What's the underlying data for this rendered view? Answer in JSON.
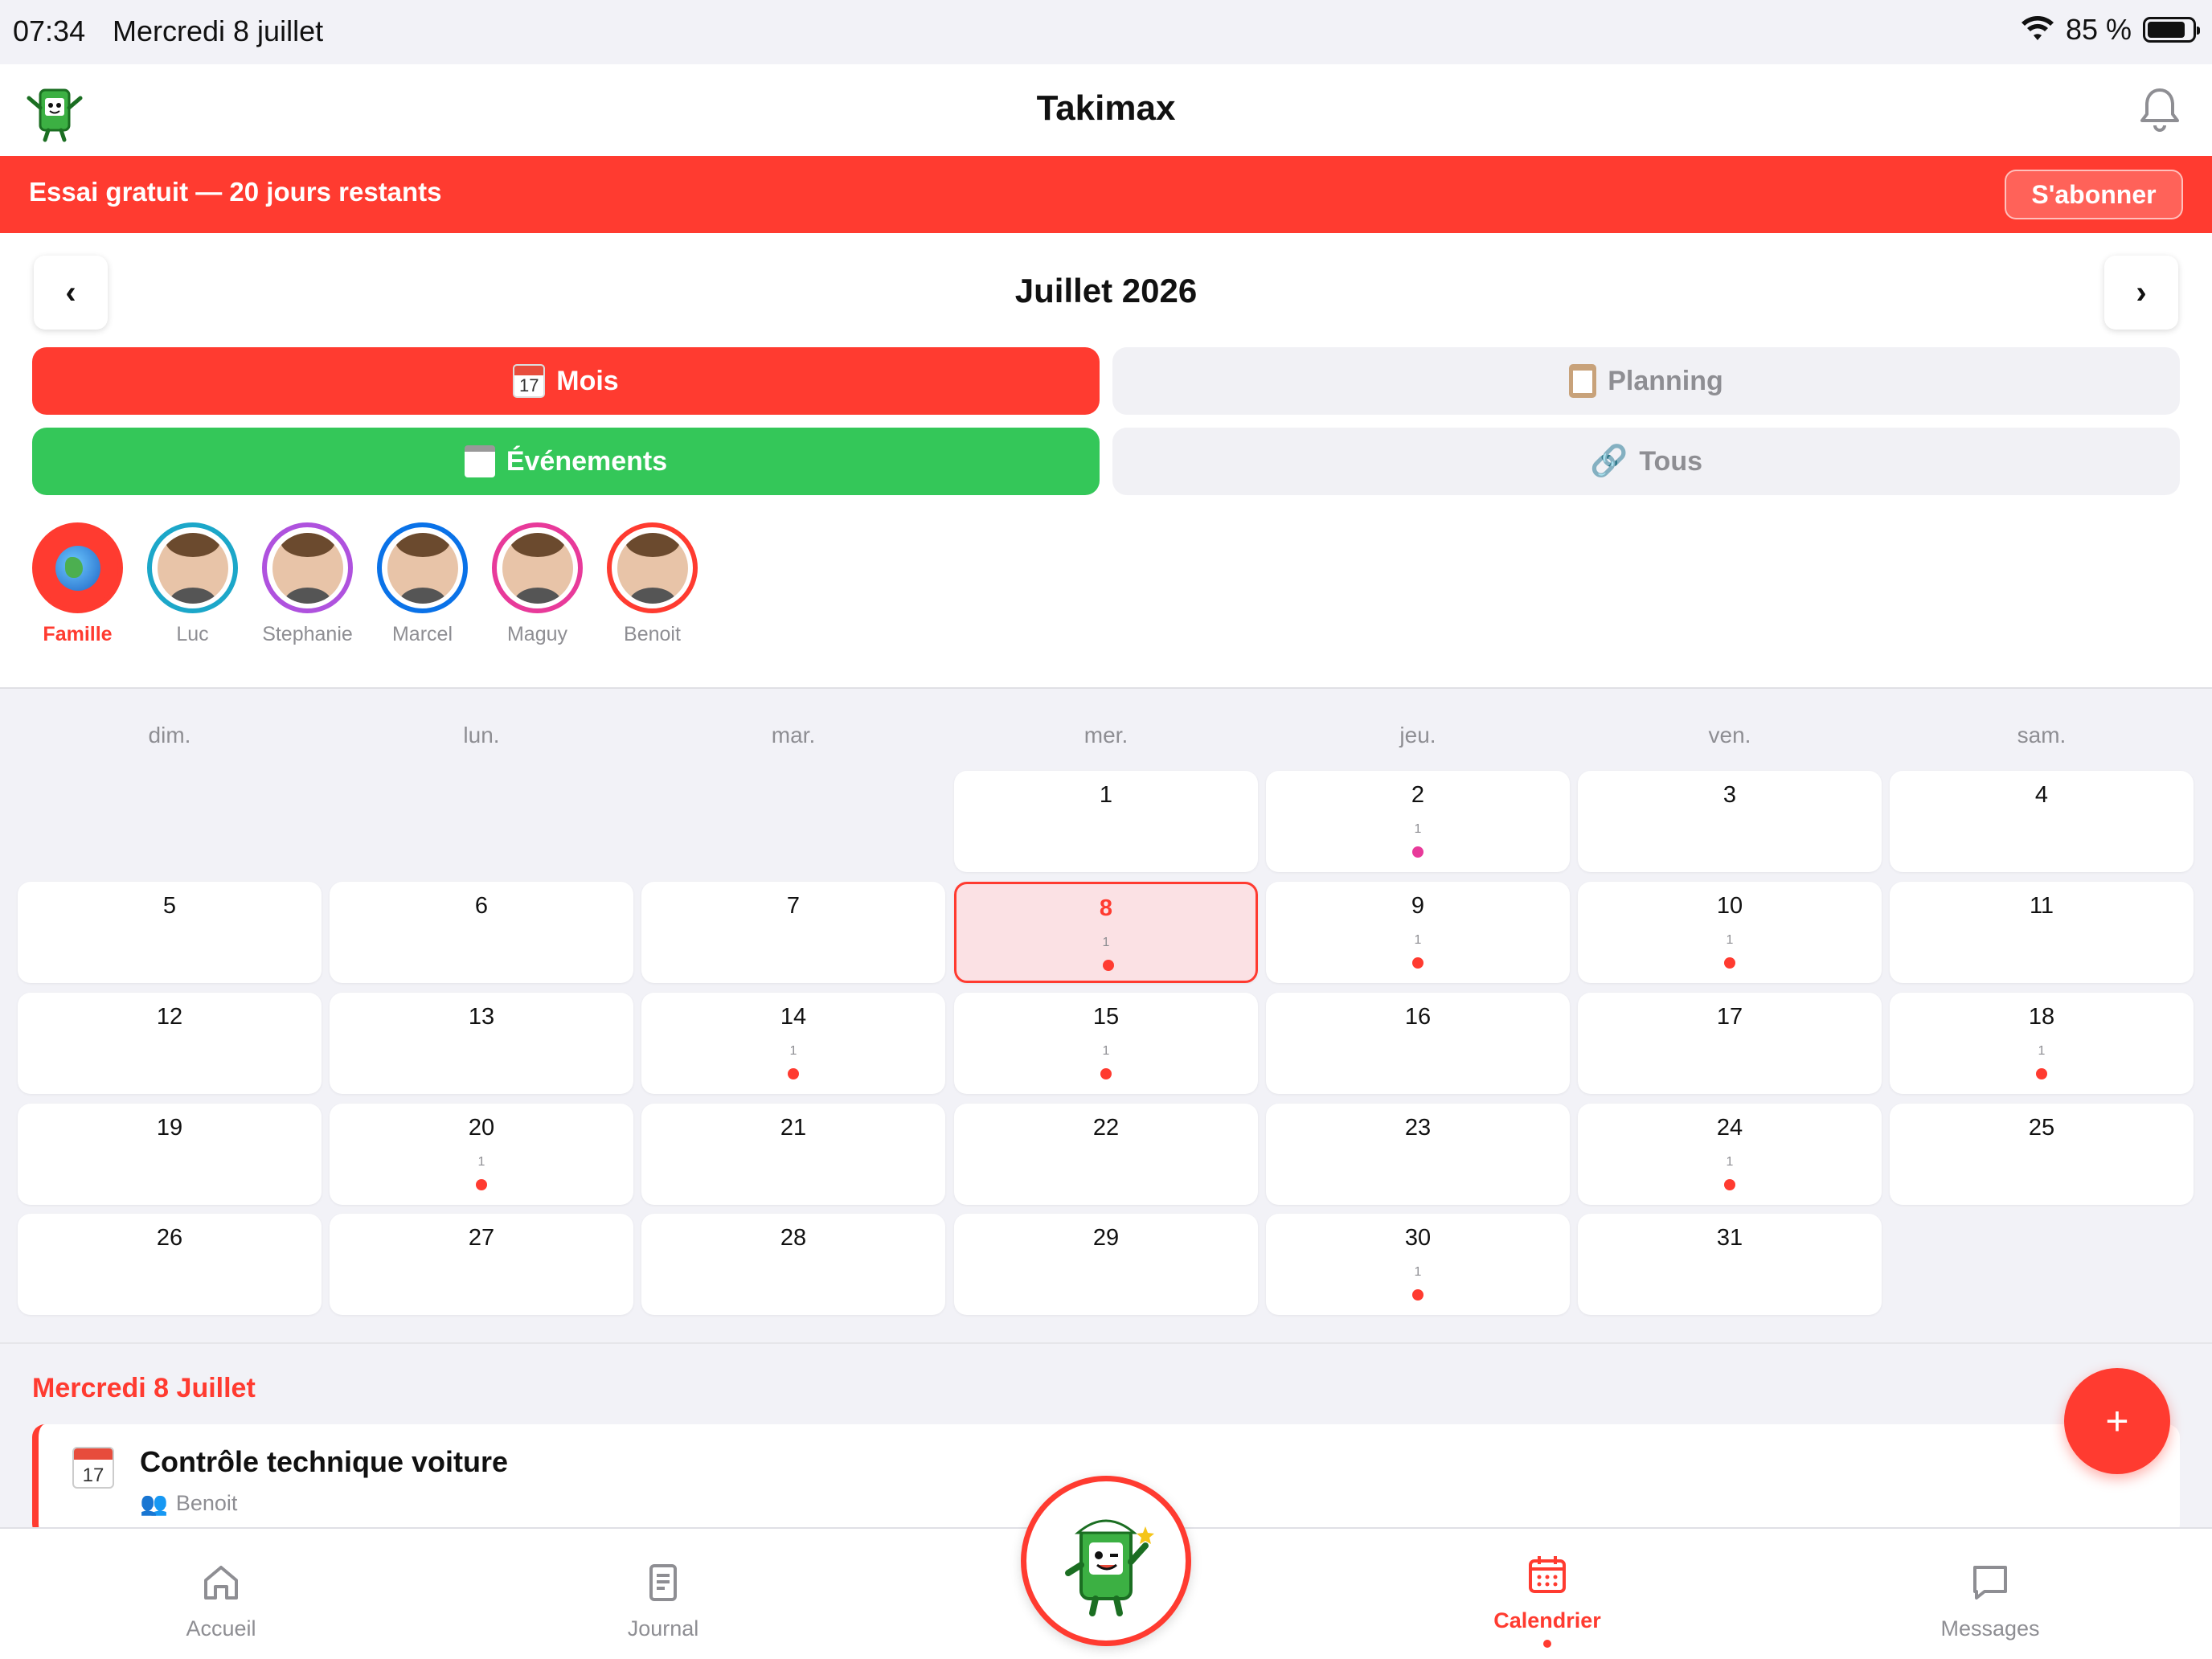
{
  "status_bar": {
    "time": "07:34",
    "date": "Mercredi 8 juillet",
    "battery": "85 %"
  },
  "header": {
    "title": "Takimax"
  },
  "banner": {
    "text": "Essai gratuit — 20 jours restants",
    "button": "S'abonner"
  },
  "calendar_nav": {
    "title": "Juillet 2026",
    "prev": "‹",
    "next": "›"
  },
  "view_tabs": {
    "month": {
      "icon_text": "17",
      "label": "Mois"
    },
    "planning": {
      "label": "Planning"
    },
    "events": {
      "label": "Événements"
    },
    "all": {
      "label": "Tous"
    }
  },
  "members": [
    {
      "name": "Famille",
      "ring_color": "#ff3b30",
      "active": true,
      "icon": "globe-icon"
    },
    {
      "name": "Luc",
      "ring_color": "#1ca7c9"
    },
    {
      "name": "Stephanie",
      "ring_color": "#af52de"
    },
    {
      "name": "Marcel",
      "ring_color": "#0a72e8"
    },
    {
      "name": "Maguy",
      "ring_color": "#e83a9a"
    },
    {
      "name": "Benoit",
      "ring_color": "#ff3b30"
    }
  ],
  "weekdays": [
    "dim.",
    "lun.",
    "mar.",
    "mer.",
    "jeu.",
    "ven.",
    "sam."
  ],
  "days": [
    {
      "day": "1",
      "count": ""
    },
    {
      "day": "2",
      "count": "1",
      "dot": "#e83a9a"
    },
    {
      "day": "3",
      "count": ""
    },
    {
      "day": "4",
      "count": ""
    },
    {
      "day": "5",
      "count": ""
    },
    {
      "day": "6",
      "count": ""
    },
    {
      "day": "7",
      "count": ""
    },
    {
      "day": "8",
      "count": "1",
      "dot": "#ff3b30",
      "today": true
    },
    {
      "day": "9",
      "count": "1",
      "dot": "#ff3b30"
    },
    {
      "day": "10",
      "count": "1",
      "dot": "#ff3b30"
    },
    {
      "day": "11",
      "count": ""
    },
    {
      "day": "12",
      "count": ""
    },
    {
      "day": "13",
      "count": ""
    },
    {
      "day": "14",
      "count": "1",
      "dot": "#ff3b30"
    },
    {
      "day": "15",
      "count": "1",
      "dot": "#ff3b30"
    },
    {
      "day": "16",
      "count": ""
    },
    {
      "day": "17",
      "count": ""
    },
    {
      "day": "18",
      "count": "1",
      "dot": "#ff3b30"
    },
    {
      "day": "19",
      "count": ""
    },
    {
      "day": "20",
      "count": "1",
      "dot": "#ff3b30"
    },
    {
      "day": "21",
      "count": ""
    },
    {
      "day": "22",
      "count": ""
    },
    {
      "day": "23",
      "count": ""
    },
    {
      "day": "24",
      "count": "1",
      "dot": "#ff3b30"
    },
    {
      "day": "25",
      "count": ""
    },
    {
      "day": "26",
      "count": ""
    },
    {
      "day": "27",
      "count": ""
    },
    {
      "day": "28",
      "count": ""
    },
    {
      "day": "29",
      "count": ""
    },
    {
      "day": "30",
      "count": "1",
      "dot": "#ff3b30"
    },
    {
      "day": "31",
      "count": ""
    }
  ],
  "first_weekday": 3,
  "selected_day": {
    "heading": "Mercredi 8 Juillet",
    "events": [
      {
        "icon_text": "17",
        "title": "Contrôle technique voiture",
        "who": "Benoit"
      }
    ]
  },
  "fab": {
    "label": "+"
  },
  "tabbar": {
    "home": "Accueil",
    "journal": "Journal",
    "calendar": "Calendrier",
    "messages": "Messages"
  },
  "colors": {
    "accent": "#ff3b30",
    "green": "#34c759"
  }
}
